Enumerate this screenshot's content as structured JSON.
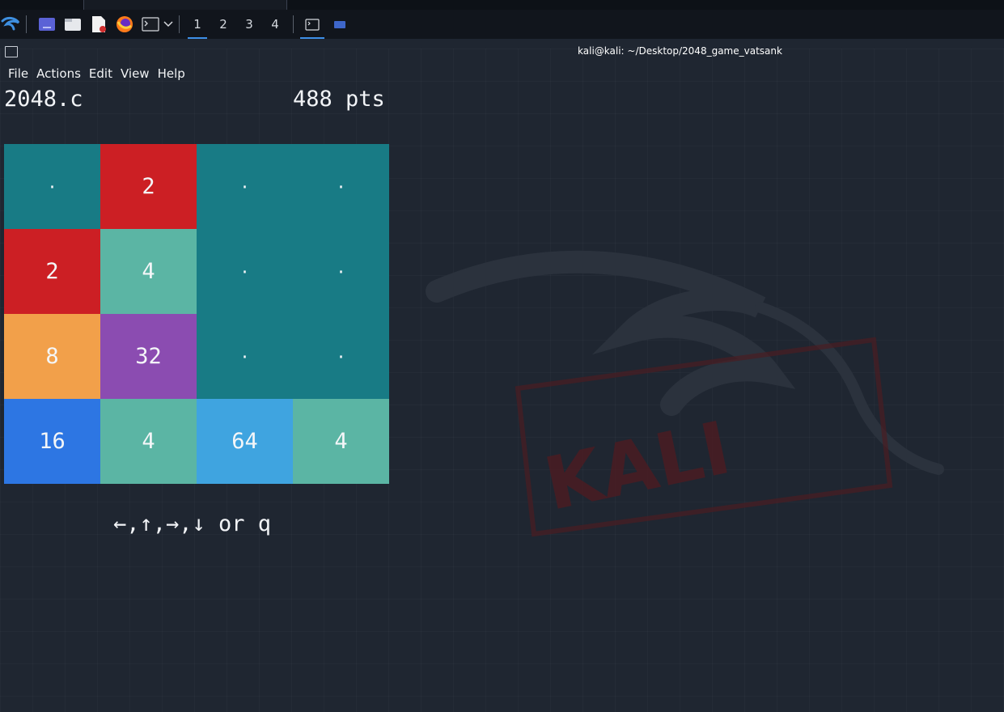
{
  "panel": {
    "workspaces": [
      "1",
      "2",
      "3",
      "4"
    ],
    "active_workspace": "1"
  },
  "window": {
    "title": "kali@kali: ~/Desktop/2048_game_vatsank"
  },
  "menu": {
    "items": [
      "File",
      "Actions",
      "Edit",
      "View",
      "Help"
    ]
  },
  "game": {
    "filename": "2048.c",
    "score": "488 pts",
    "board": [
      [
        "·",
        "2",
        "·",
        "·"
      ],
      [
        "2",
        "4",
        "·",
        "·"
      ],
      [
        "8",
        "32",
        "·",
        "·"
      ],
      [
        "16",
        "4",
        "64",
        "4"
      ]
    ],
    "tile_colors": {
      "·": "#187b85",
      "2": "#cc1f24",
      "4": "#5bb5a4",
      "8": "#f2a04a",
      "16": "#2d76e3",
      "32": "#8b4cb1",
      "64": "#3fa4e0"
    },
    "controls_hint": "←,↑,→,↓ or q"
  }
}
